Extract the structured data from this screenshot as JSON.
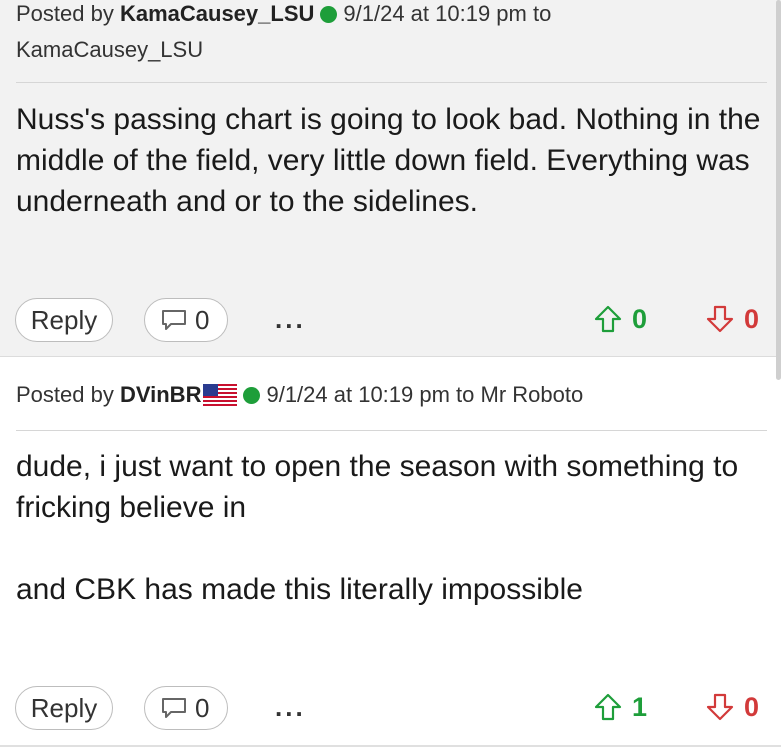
{
  "posts": [
    {
      "posted_by_prefix": "Posted by",
      "author": "KamaCausey_LSU",
      "online": true,
      "timestamp": "9/1/24 at 10:19 pm to",
      "reply_to": "KamaCausey_LSU",
      "body": "Nuss's passing chart is going to look bad. Nothing in the middle of the field, very little down field. Everything was underneath and or to the sidelines.",
      "reply_label": "Reply",
      "quote_count": "0",
      "more_label": "...",
      "upvotes": "0",
      "downvotes": "0"
    },
    {
      "posted_by_prefix": "Posted by",
      "author": "DVinBR",
      "has_flag": "us-flag-icon",
      "online": true,
      "timestamp": "9/1/24 at 10:19 pm to",
      "reply_to": "Mr Roboto",
      "body": "dude, i just want to open the season with something to fricking believe in\n\nand CBK has made this literally impossible",
      "reply_label": "Reply",
      "quote_count": "0",
      "more_label": "...",
      "upvotes": "1",
      "downvotes": "0"
    }
  ],
  "colors": {
    "online_dot": "#1e9e3a",
    "upvote": "#1e9e3a",
    "downvote": "#d23a3a",
    "post_bg_alt": "#f2f2f2"
  }
}
